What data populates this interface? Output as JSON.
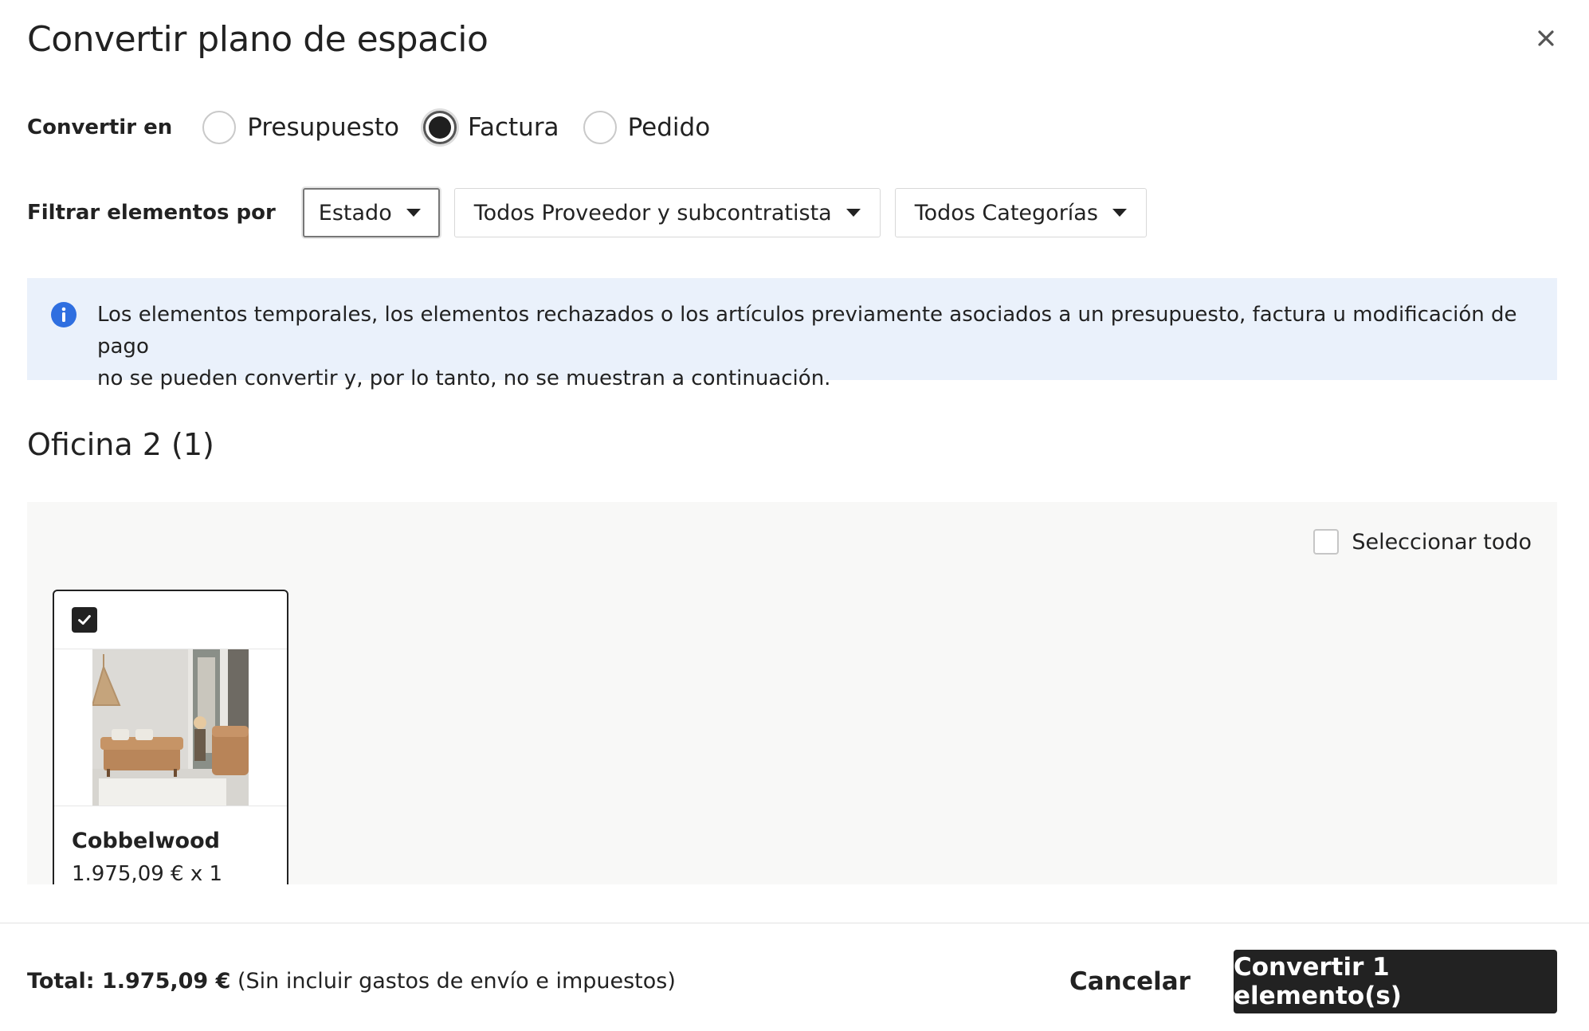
{
  "dialog": {
    "title": "Convertir plano de espacio",
    "close_icon": "close-icon"
  },
  "convert": {
    "label": "Convertir en",
    "options": [
      {
        "label": "Presupuesto",
        "checked": false
      },
      {
        "label": "Factura",
        "checked": true
      },
      {
        "label": "Pedido",
        "checked": false
      }
    ]
  },
  "filter": {
    "label": "Filtrar elementos por",
    "selects": [
      {
        "value": "Estado"
      },
      {
        "value": "Todos Proveedor y subcontratista"
      },
      {
        "value": "Todos Categorías"
      }
    ]
  },
  "info": {
    "icon": "info-icon",
    "color": "#2f6fe0",
    "line1": "Los elementos temporales, los elementos rechazados o los artículos previamente asociados a un presupuesto, factura u modificación de pago",
    "line2": "no se pueden convertir y, por lo tanto, no se muestran a continuación."
  },
  "section": {
    "title": "Oficina 2 (1)",
    "select_all_label": "Seleccionar todo",
    "items": [
      {
        "name": "Cobbelwood",
        "price": "1.975,09 € x 1",
        "checked": true
      }
    ]
  },
  "footer": {
    "total_label": "Total: 1.975,09 €",
    "total_note": "(Sin incluir gastos de envío e impuestos)",
    "cancel_label": "Cancelar",
    "convert_label": "Convertir 1 elemento(s)"
  }
}
